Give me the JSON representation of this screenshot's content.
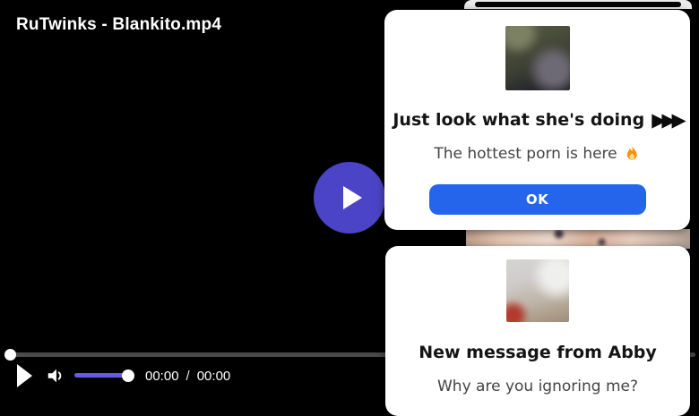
{
  "player": {
    "title": "RuTwinks - Blankito.mp4",
    "current_time": "00:00",
    "time_separator": "/",
    "duration": "00:00"
  },
  "popups": {
    "offer": {
      "title": "Just look what she's doing",
      "arrows": "▶▶▶",
      "subtitle": "The hottest porn is here",
      "fire_icon": "fire-emoji",
      "ok_label": "OK"
    },
    "message": {
      "title": "New message from Abby",
      "subtitle": "Why are you ignoring me?"
    }
  },
  "colors": {
    "play_overlay": "#4c44c7",
    "volume_fill": "#695ae3",
    "ok_button": "#2565ec",
    "seek_track": "#4a4a4a",
    "card_background": "#ffffff"
  }
}
